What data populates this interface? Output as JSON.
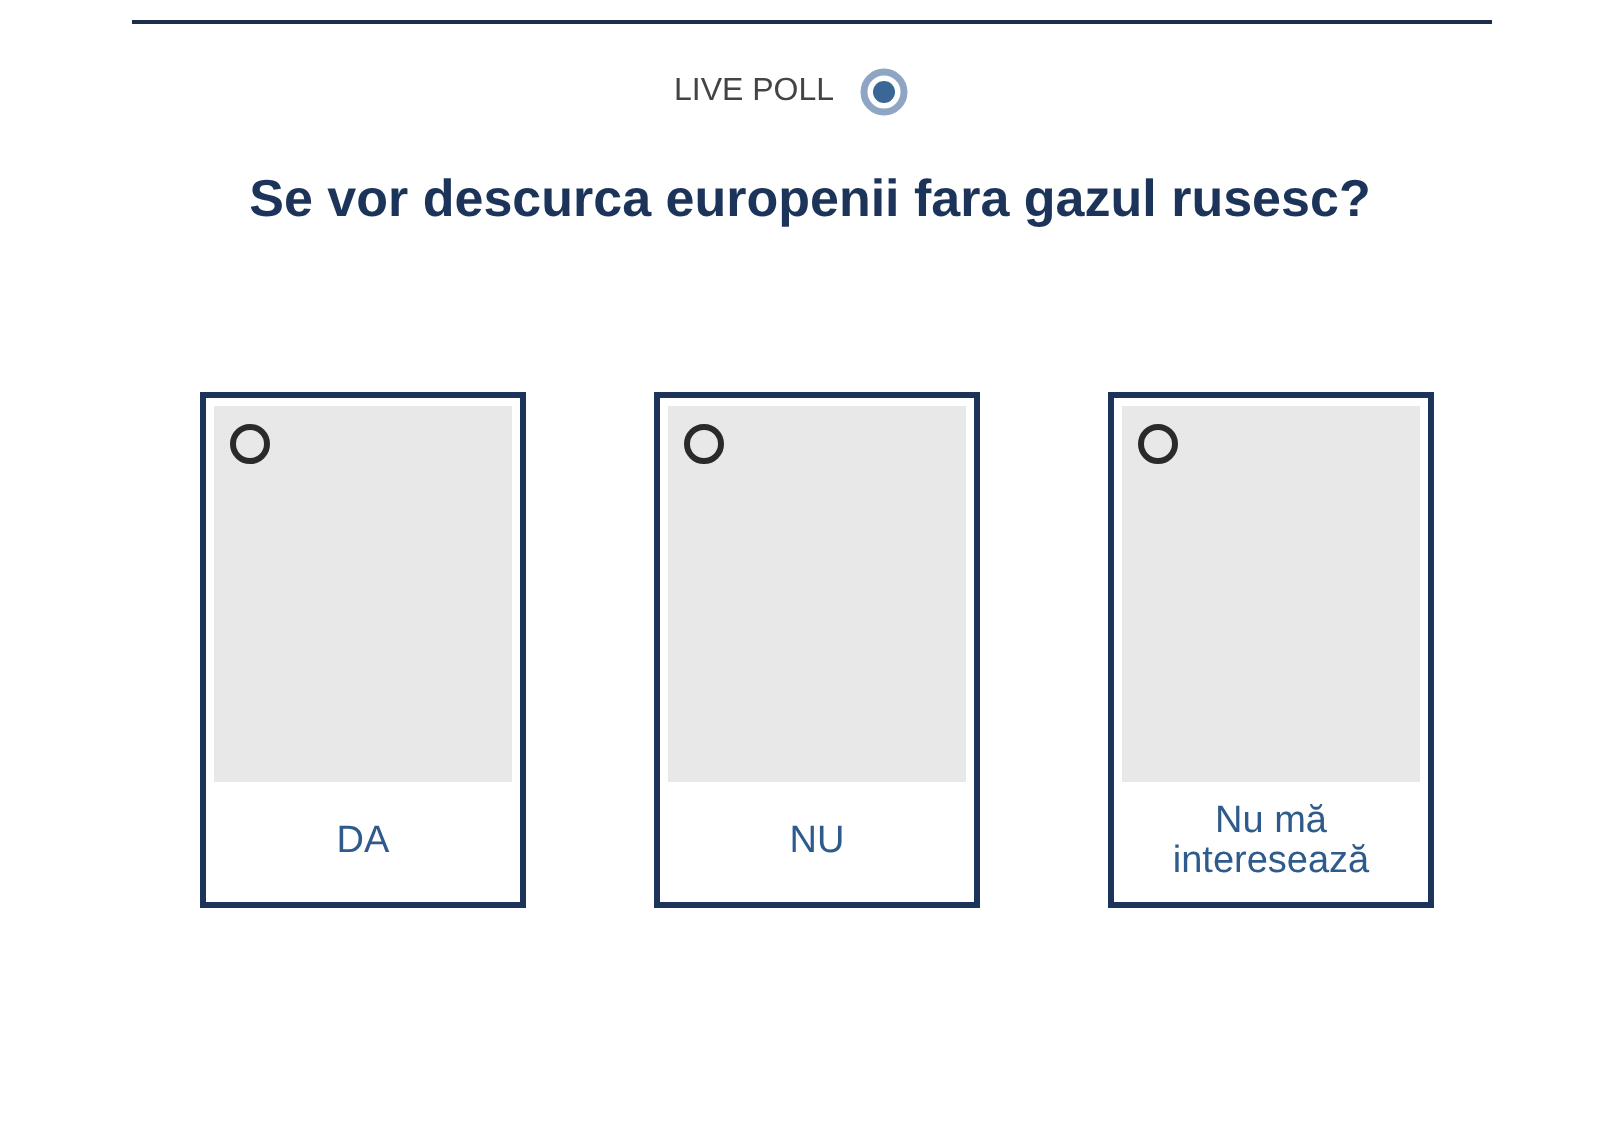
{
  "header": {
    "label": "LIVE POLL"
  },
  "question": "Se vor descurca europenii fara gazul rusesc?",
  "options": [
    {
      "label": "DA",
      "selected": false
    },
    {
      "label": "NU",
      "selected": false
    },
    {
      "label": "Nu mă interesează",
      "selected": false
    }
  ]
}
